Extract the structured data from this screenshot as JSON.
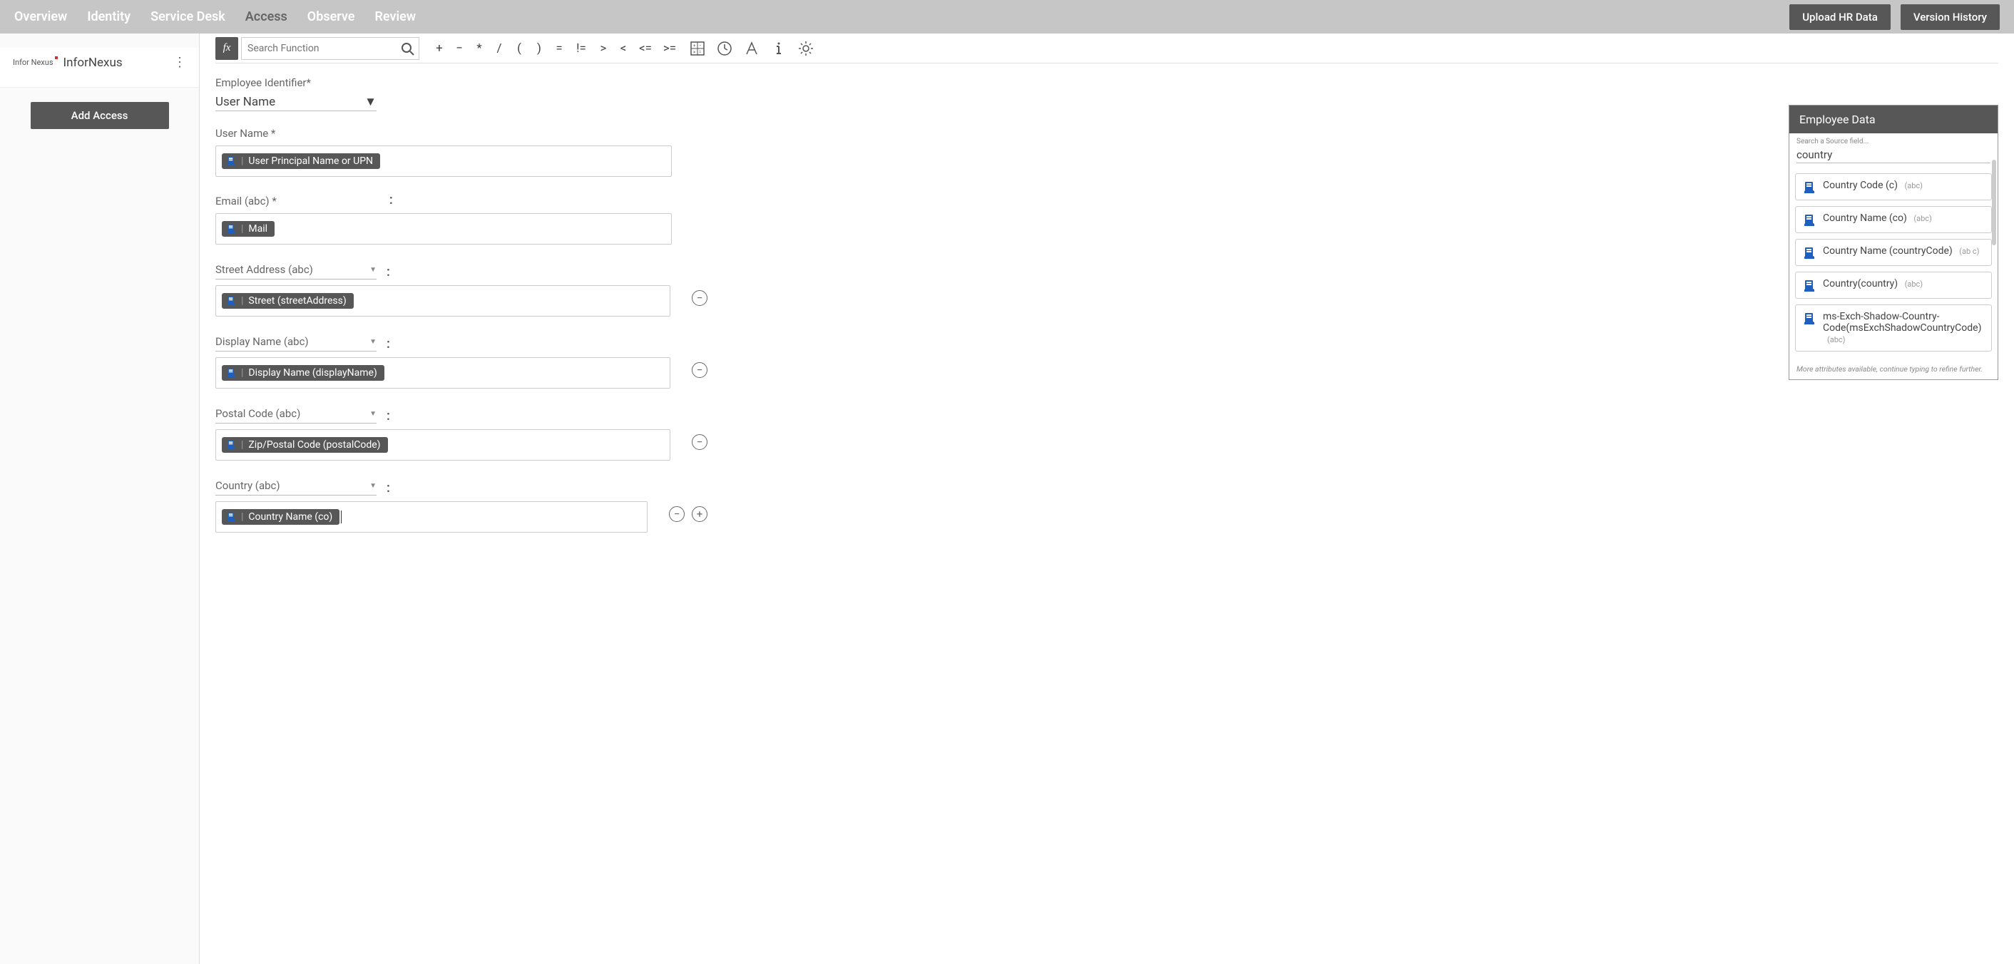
{
  "nav": {
    "items": [
      "Overview",
      "Identity",
      "Service Desk",
      "Access",
      "Observe",
      "Review"
    ],
    "active_index": 3,
    "upload_btn": "Upload HR Data",
    "history_btn": "Version History"
  },
  "sidebar": {
    "logo_text": "Infor Nexus",
    "app_name": "InforNexus",
    "add_access": "Add Access"
  },
  "formula": {
    "search_placeholder": "Search Function",
    "operators": [
      "+",
      "−",
      "*",
      "/",
      "(",
      ")",
      "=",
      "!=",
      ">",
      "<",
      "<=",
      ">="
    ]
  },
  "emp_id": {
    "label": "Employee Identifier*",
    "value": "User Name"
  },
  "fields": [
    {
      "label": "User Name *",
      "type": "static",
      "chip": "User Principal Name or UPN",
      "actions": []
    },
    {
      "label": "Email (abc) *",
      "type": "static",
      "chip": "Mail",
      "actions": []
    },
    {
      "label": "Street Address (abc)",
      "type": "select",
      "chip": "Street (streetAddress)",
      "actions": [
        "remove"
      ]
    },
    {
      "label": "Display Name (abc)",
      "type": "select",
      "chip": "Display Name (displayName)",
      "actions": [
        "remove"
      ]
    },
    {
      "label": "Postal Code (abc)",
      "type": "select",
      "chip": "Zip/Postal Code (postalCode)",
      "actions": [
        "remove"
      ]
    },
    {
      "label": "Country (abc)",
      "type": "select",
      "chip": "Country Name (co)",
      "actions": [
        "remove",
        "add"
      ],
      "cursor": true
    }
  ],
  "panel": {
    "title": "Employee Data",
    "search_label": "Search a Source field...",
    "search_value": "country",
    "items": [
      {
        "name": "Country Code (c)",
        "type": "(abc)"
      },
      {
        "name": "Country Name (co)",
        "type": "(abc)"
      },
      {
        "name": "Country Name (countryCode)",
        "type": "(ab c)"
      },
      {
        "name": "Country(country)",
        "type": "(abc)"
      },
      {
        "name": "ms-Exch-Shadow-Country-Code(msExchShadowCountryCode)",
        "type": "(abc)"
      }
    ],
    "footer": "More attributes available, continue typing to refine further."
  }
}
